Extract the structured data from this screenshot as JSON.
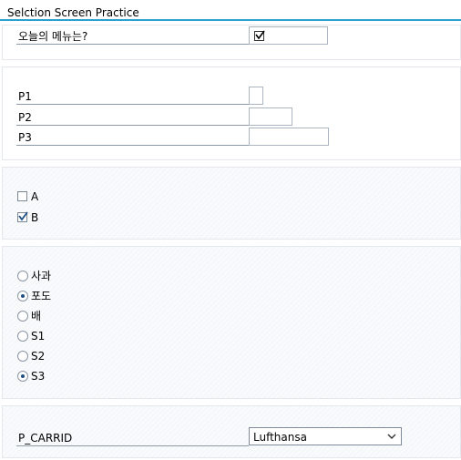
{
  "title": "Selction Screen Practice",
  "question": {
    "label": "오늘의 메뉴는?",
    "checked": true
  },
  "params": [
    {
      "label": "P1"
    },
    {
      "label": "P2"
    },
    {
      "label": "P3"
    }
  ],
  "checkboxes": [
    {
      "label": "A",
      "checked": false
    },
    {
      "label": "B",
      "checked": true
    }
  ],
  "radios": [
    {
      "label": "사과",
      "selected": false
    },
    {
      "label": "포도",
      "selected": true
    },
    {
      "label": "배",
      "selected": false
    },
    {
      "label": "S1",
      "selected": false
    },
    {
      "label": "S2",
      "selected": false
    },
    {
      "label": "S3",
      "selected": true
    }
  ],
  "carrid": {
    "label": "P_CARRID",
    "value": "Lufthansa"
  },
  "colors": {
    "accent": "#2aa0d4",
    "check": "#1f4f86"
  }
}
